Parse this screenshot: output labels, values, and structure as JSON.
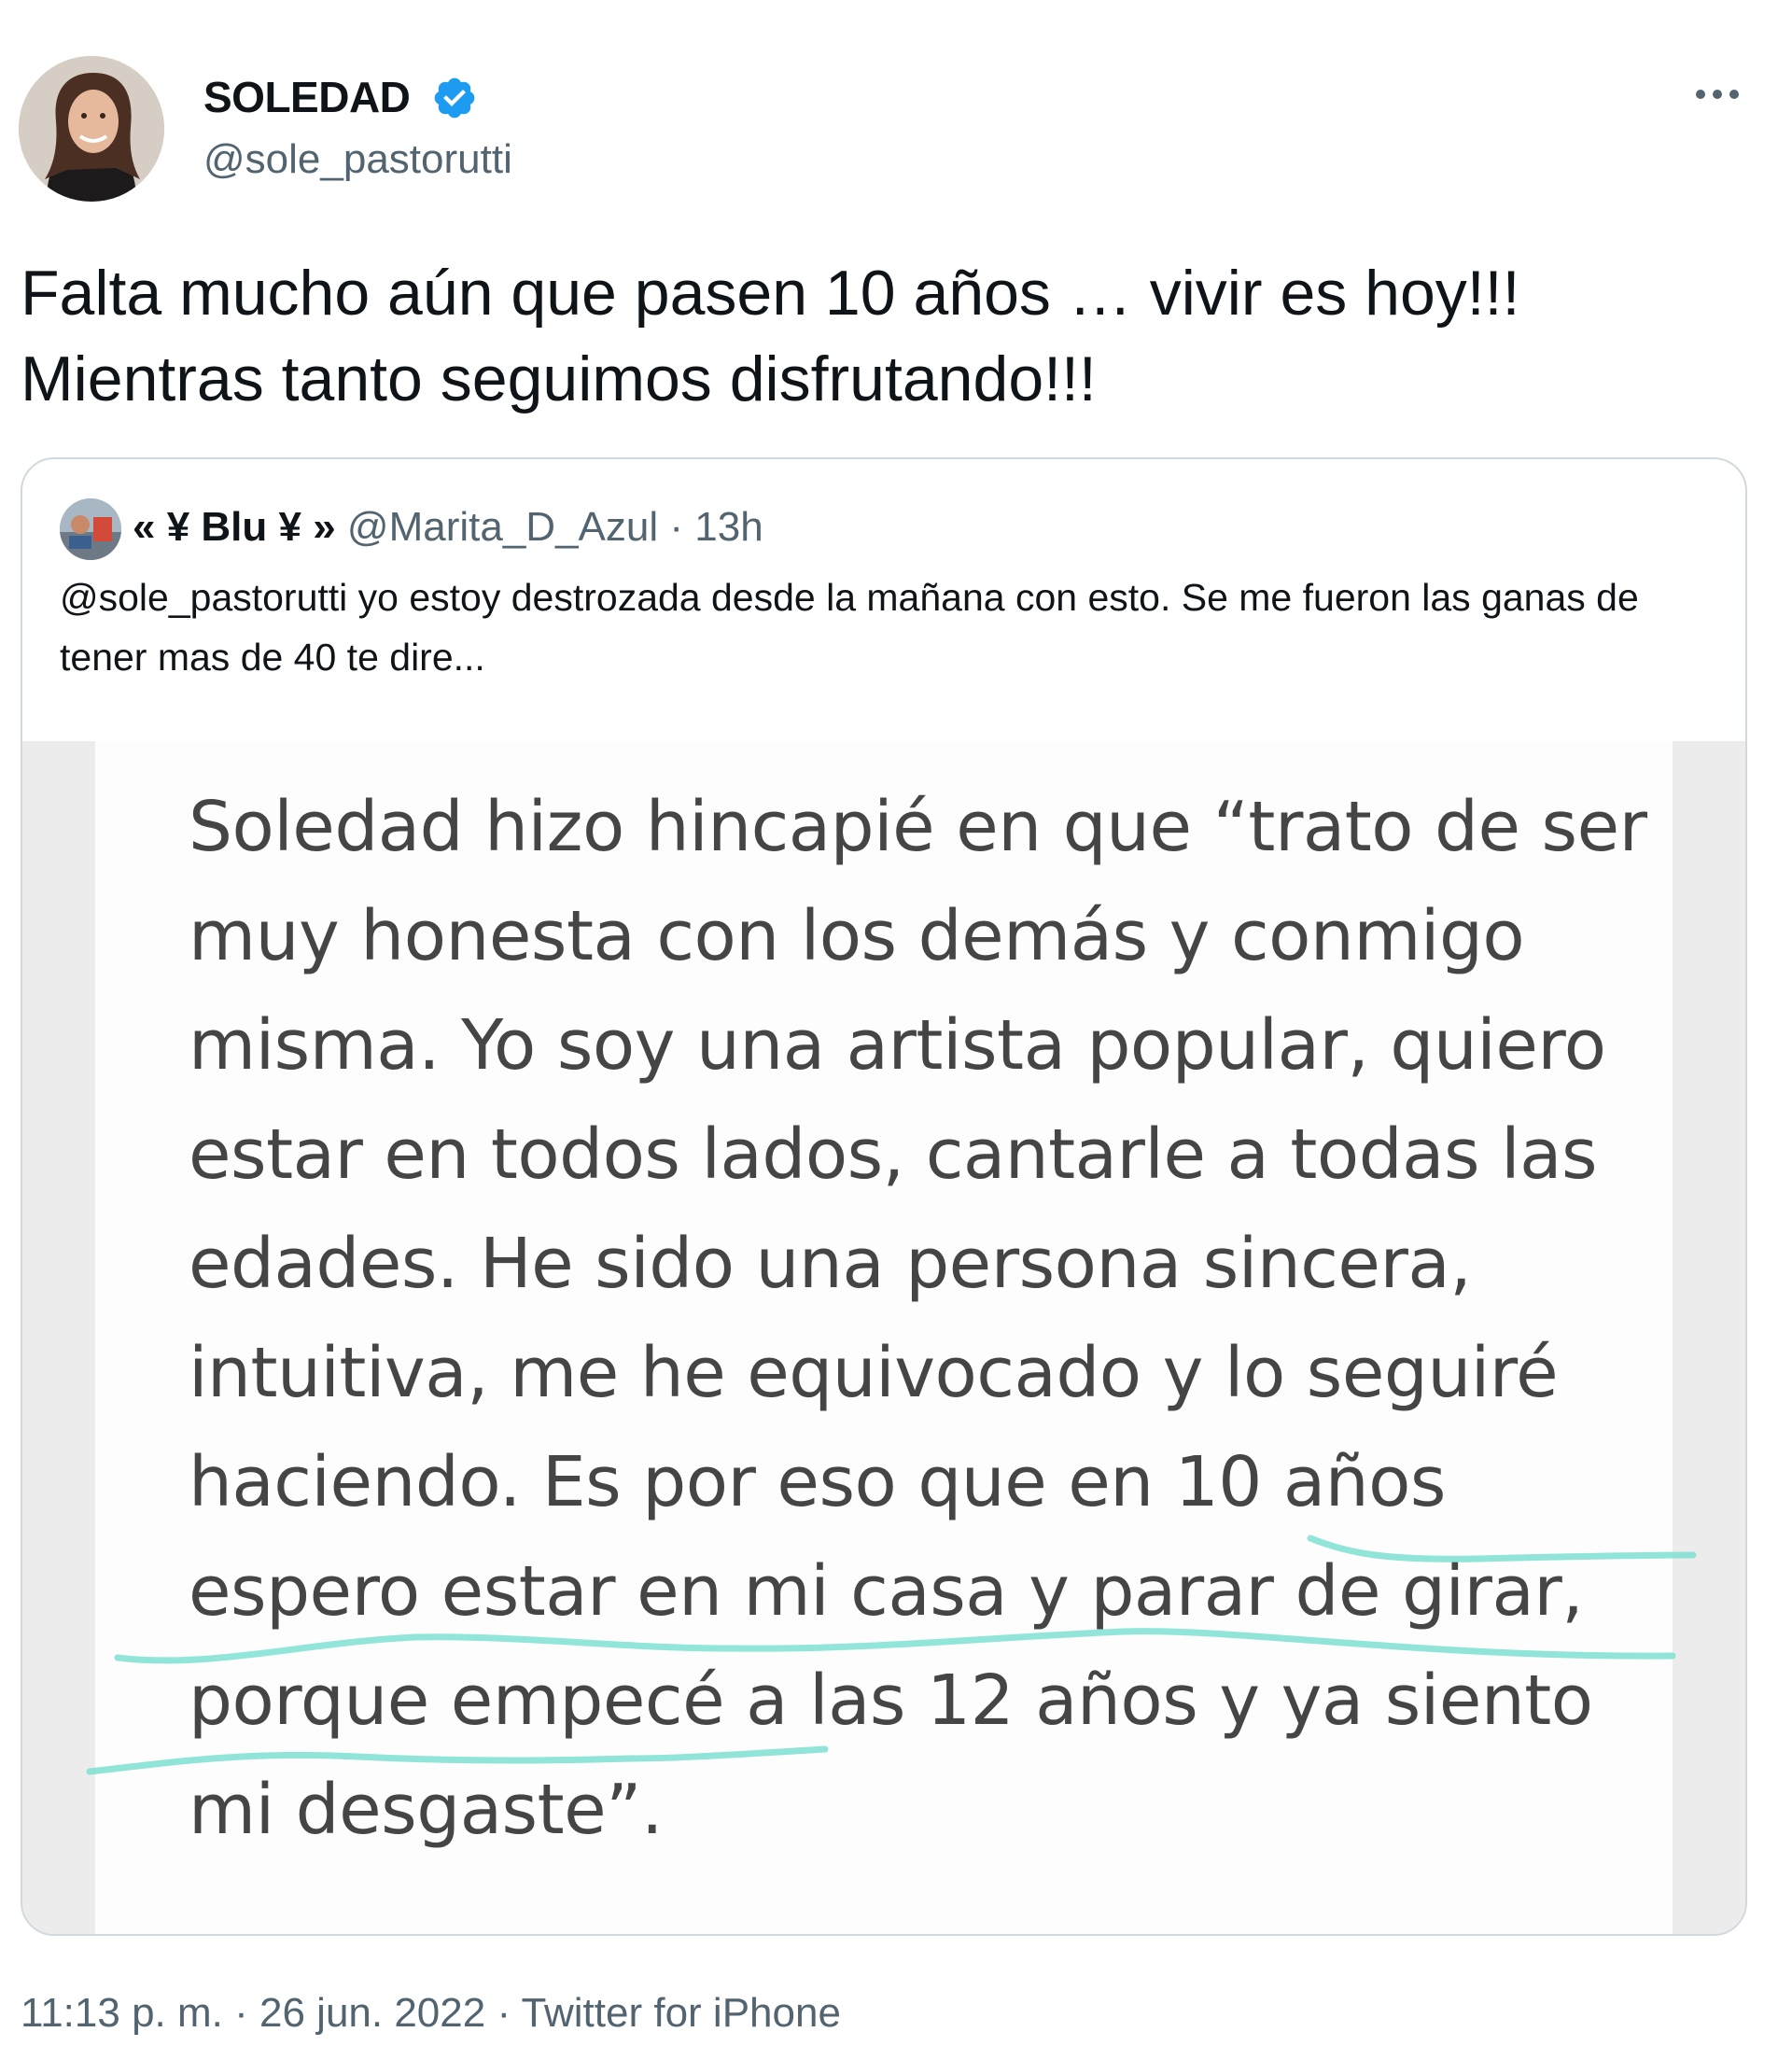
{
  "author": {
    "display_name": "SOLEDAD",
    "handle": "@sole_pastorutti",
    "verified": true,
    "avatar_icon": "profile-photo"
  },
  "tweet": {
    "text": "Falta mucho aún que pasen 10 años  … vivir es hoy!!!\nMientras tanto seguimos disfrutando!!!"
  },
  "quoted_tweet": {
    "display_name": "« ¥ Blu ¥ »",
    "handle": "@Marita_D_Azul",
    "separator": "·",
    "time_ago": "13h",
    "text": "@sole_pastorutti yo estoy destrozada desde la mañana con esto. Se me fueron las ganas de tener mas de 40 te dire...",
    "media_text": "Soledad hizo hincapié en que “trato de ser muy honesta con los demás y conmigo misma. Yo soy una artista popular, quiero estar en todos lados, cantarle a todas las edades. He sido una persona sincera, intuitiva, me he equivocado y lo seguiré haciendo. Es por eso que en 10 años espero estar en mi casa y parar de girar, porque empecé a las 12 años y ya siento mi desgaste”.",
    "highlight_color": "#7fe0d2"
  },
  "footer": {
    "time": "11:13 p. m.",
    "separator": "·",
    "date": "26 jun. 2022",
    "source": "Twitter for iPhone"
  },
  "colors": {
    "text_primary": "#0f1419",
    "text_secondary": "#536471",
    "verified_blue": "#1d9bf0",
    "card_border": "#cfd9de"
  }
}
